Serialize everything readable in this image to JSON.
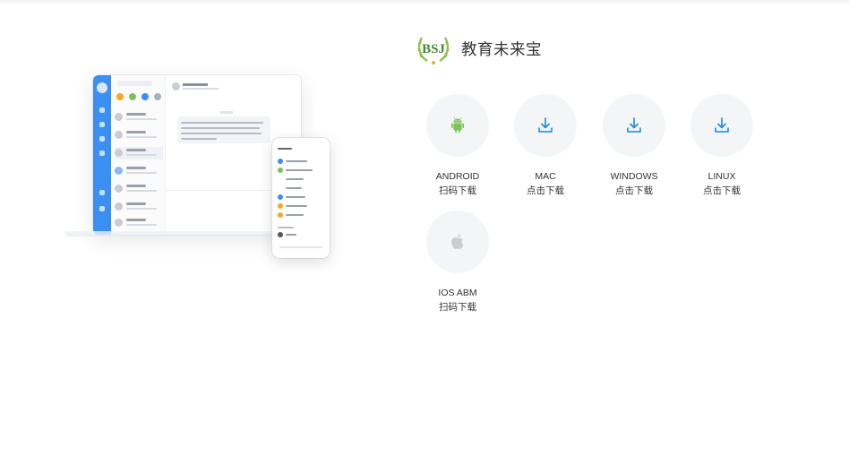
{
  "brand": {
    "logo_text": "BSJ",
    "title": "教育未来宝"
  },
  "downloads": [
    {
      "id": "android",
      "platform": "ANDROID",
      "action": "扫码下载",
      "icon": "android-icon"
    },
    {
      "id": "mac",
      "platform": "MAC",
      "action": "点击下载",
      "icon": "download-icon"
    },
    {
      "id": "windows",
      "platform": "WINDOWS",
      "action": "点击下载",
      "icon": "download-icon"
    },
    {
      "id": "linux",
      "platform": "LINUX",
      "action": "点击下载",
      "icon": "download-icon"
    },
    {
      "id": "ios-abm",
      "platform": "IOS ABM",
      "action": "扫码下载",
      "icon": "apple-icon"
    }
  ],
  "colors": {
    "accent": "#1b8ad6",
    "android": "#7cc35a",
    "apple": "#c9cdd2",
    "circle_bg": "#f4f5f7",
    "logo_green": "#3f8a2a",
    "mock_sidebar": "#3b8ff0"
  }
}
